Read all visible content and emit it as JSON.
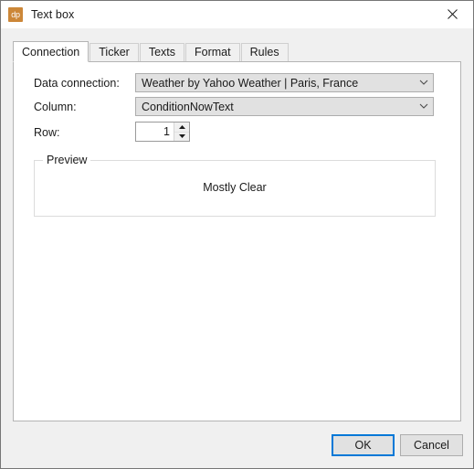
{
  "window": {
    "title": "Text box",
    "app_icon_label": "dp",
    "close_label": "×"
  },
  "tabs": [
    {
      "label": "Connection",
      "active": true
    },
    {
      "label": "Ticker",
      "active": false
    },
    {
      "label": "Texts",
      "active": false
    },
    {
      "label": "Format",
      "active": false
    },
    {
      "label": "Rules",
      "active": false
    }
  ],
  "form": {
    "data_connection": {
      "label": "Data connection:",
      "value": "Weather by Yahoo Weather | Paris, France"
    },
    "column": {
      "label": "Column:",
      "value": "ConditionNowText"
    },
    "row": {
      "label": "Row:",
      "value": "1"
    }
  },
  "preview": {
    "title": "Preview",
    "value": "Mostly Clear"
  },
  "footer": {
    "ok_label": "OK",
    "cancel_label": "Cancel"
  },
  "colors": {
    "accent": "#0078d7",
    "icon_orange": "#cc8738",
    "dialog_bg": "#f0f0f0",
    "panel_bg": "#ffffff",
    "control_bg": "#e1e1e1"
  }
}
